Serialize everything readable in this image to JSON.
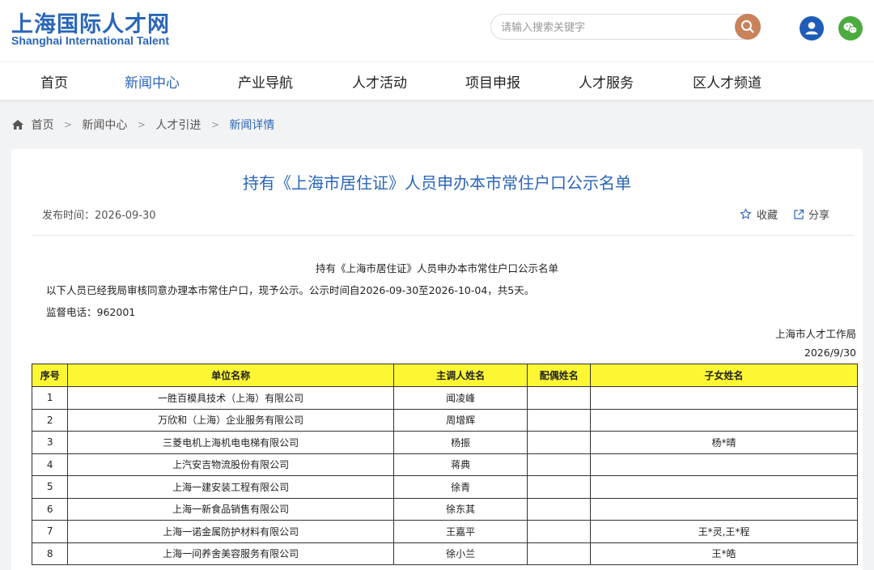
{
  "header": {
    "logo_cn": "上海国际人才网",
    "logo_en": "Shanghai International Talent",
    "search_placeholder": "请输入搜索关键字"
  },
  "nav": {
    "items": [
      {
        "label": "首页",
        "active": false
      },
      {
        "label": "新闻中心",
        "active": true
      },
      {
        "label": "产业导航",
        "active": false
      },
      {
        "label": "人才活动",
        "active": false
      },
      {
        "label": "项目申报",
        "active": false
      },
      {
        "label": "人才服务",
        "active": false
      },
      {
        "label": "区人才频道",
        "active": false
      }
    ]
  },
  "breadcrumb": {
    "home": "首页",
    "level1": "新闻中心",
    "level2": "人才引进",
    "current": "新闻详情"
  },
  "article": {
    "title": "持有《上海市居住证》人员申办本市常住户口公示名单",
    "publish_label": "发布时间：",
    "publish_date": "2026-09-30",
    "favorite_label": "收藏",
    "share_label": "分享"
  },
  "document": {
    "title": "持有《上海市居住证》人员申办本市常住户口公示名单",
    "intro": "以下人员已经我局审核同意办理本市常住户口，现予公示。公示时间自2026-09-30至2026-10-04，共5天。",
    "phone_label": "监督电话：",
    "phone": "962001",
    "issuer": "上海市人才工作局",
    "date": "2026/9/30"
  },
  "table": {
    "headers": {
      "index": "序号",
      "unit": "单位名称",
      "main": "主调人姓名",
      "spouse": "配偶姓名",
      "children": "子女姓名"
    },
    "rows": [
      {
        "index": "1",
        "unit": "一胜百模具技术（上海）有限公司",
        "main": "闻凌峰",
        "spouse": "",
        "children": ""
      },
      {
        "index": "2",
        "unit": "万欣和（上海）企业服务有限公司",
        "main": "周增辉",
        "spouse": "",
        "children": ""
      },
      {
        "index": "3",
        "unit": "三菱电机上海机电电梯有限公司",
        "main": "杨振",
        "spouse": "",
        "children": "杨*晴"
      },
      {
        "index": "4",
        "unit": "上汽安吉物流股份有限公司",
        "main": "蒋典",
        "spouse": "",
        "children": ""
      },
      {
        "index": "5",
        "unit": "上海一建安装工程有限公司",
        "main": "徐青",
        "spouse": "",
        "children": ""
      },
      {
        "index": "6",
        "unit": "上海一新食品销售有限公司",
        "main": "徐东其",
        "spouse": "",
        "children": ""
      },
      {
        "index": "7",
        "unit": "上海一诺金属防护材料有限公司",
        "main": "王嘉平",
        "spouse": "",
        "children": "王*灵,王*程"
      },
      {
        "index": "8",
        "unit": "上海一间养舍美容服务有限公司",
        "main": "徐小兰",
        "spouse": "",
        "children": "王*皓"
      }
    ]
  },
  "colors": {
    "brand": "#2a66b8",
    "search_button": "#c8835a",
    "user_icon": "#1f5bb8",
    "wechat_icon": "#4bab3f",
    "table_header": "#fdf733"
  },
  "icons": {
    "search": "search-icon",
    "user": "user-icon",
    "wechat": "wechat-icon",
    "home": "home-icon",
    "favorite": "star-icon",
    "share": "share-icon"
  }
}
